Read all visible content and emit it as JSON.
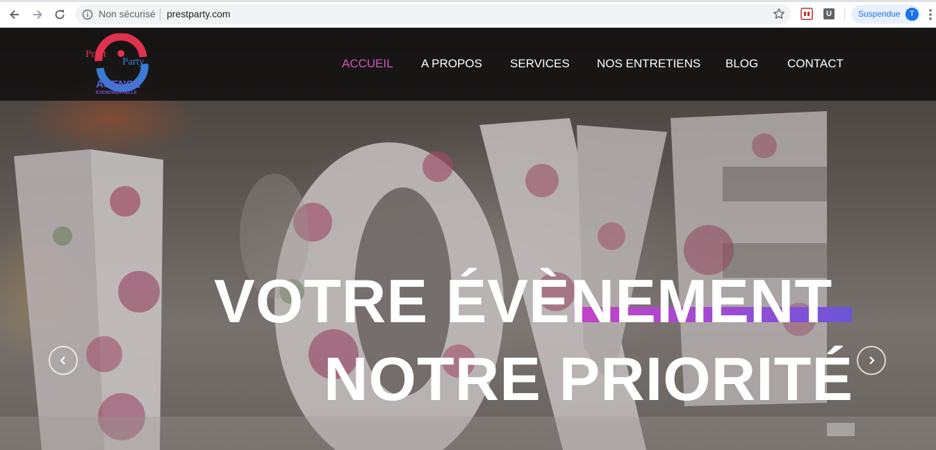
{
  "browser": {
    "security_label": "Non sécurisé",
    "url": "prestparty.com",
    "profile_status": "Suspendue",
    "profile_initial": "T",
    "extension_letter": "U"
  },
  "site": {
    "logo": {
      "text_prest": "Prest",
      "text_party": "Party",
      "text_agence": "AGENCE",
      "text_sub": "EVENEMENTIELLE"
    },
    "nav": {
      "items": [
        {
          "label": "ACCUEIL",
          "active": true
        },
        {
          "label": "A PROPOS",
          "active": false
        },
        {
          "label": "SERVICES",
          "active": false
        },
        {
          "label": "NOS ENTRETIENS",
          "active": false
        },
        {
          "label": "BLOG",
          "active": false
        },
        {
          "label": "CONTACT",
          "active": false
        }
      ]
    },
    "hero": {
      "line1": "VOTRE ÉVÈNEMENT",
      "line2": "NOTRE PRIORITÉ"
    },
    "colors": {
      "nav_active": "#d15ab9",
      "accent_start": "#c442c6",
      "accent_end": "#6a56d8"
    }
  }
}
